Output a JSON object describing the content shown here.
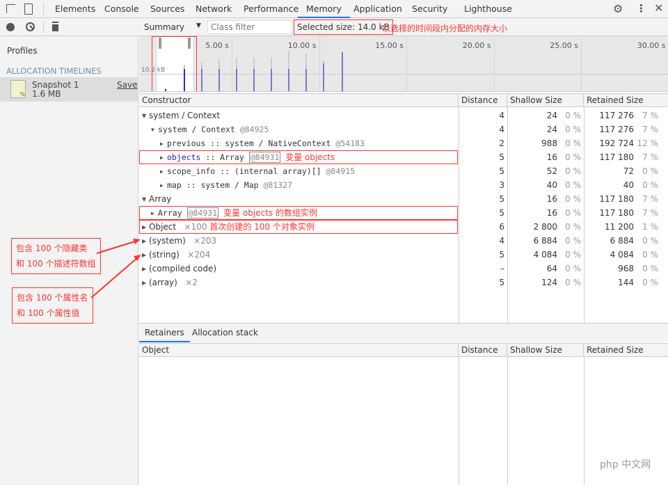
{
  "tabs": [
    "Elements",
    "Console",
    "Sources",
    "Network",
    "Performance",
    "Memory",
    "Application",
    "Security",
    "Lighthouse"
  ],
  "active_tab": "Memory",
  "toolbar": {
    "view": "Summary",
    "class_filter_placeholder": "Class filter",
    "selected_size": "Selected size: 14.0 kB",
    "selected_note": "以选择的时间段内分配的内存大小"
  },
  "sidebar": {
    "profiles": "Profiles",
    "section": "ALLOCATION TIMELINES",
    "snapshot_name": "Snapshot 1",
    "snapshot_size": "1.6 MB",
    "save": "Save"
  },
  "timeline": {
    "ticks": [
      "5.00 s",
      "10.00 s",
      "15.00 s",
      "20.00 s",
      "25.00 s",
      "30.00 s"
    ],
    "size_label": "10.2 kB"
  },
  "columns": [
    "Constructor",
    "Distance",
    "Shallow Size",
    "Retained Size"
  ],
  "rows": [
    {
      "indent": 0,
      "open": true,
      "name": "system / Context",
      "count": "",
      "distance": "4",
      "shallow": "24",
      "shallow_pct": "0 %",
      "retained": "117 276",
      "retained_pct": "7 %"
    },
    {
      "indent": 1,
      "open": true,
      "mono": true,
      "name": "system / Context",
      "id": "@84925",
      "distance": "4",
      "shallow": "24",
      "shallow_pct": "0 %",
      "retained": "117 276",
      "retained_pct": "7 %"
    },
    {
      "indent": 2,
      "mono": true,
      "name": "previous :: system / NativeContext",
      "id": "@54183",
      "distance": "2",
      "shallow": "988",
      "shallow_pct": "0 %",
      "retained": "192 724",
      "retained_pct": "12 %"
    },
    {
      "indent": 2,
      "mono": true,
      "prop": "objects",
      "name": " :: Array",
      "boxid": "@84931",
      "note": "变量 objects",
      "distance": "5",
      "shallow": "16",
      "shallow_pct": "0 %",
      "retained": "117 180",
      "retained_pct": "7 %"
    },
    {
      "indent": 2,
      "mono": true,
      "name": "scope_info :: (internal array)[]",
      "id": "@84915",
      "distance": "5",
      "shallow": "52",
      "shallow_pct": "0 %",
      "retained": "72",
      "retained_pct": "0 %"
    },
    {
      "indent": 2,
      "mono": true,
      "name": "map :: system / Map",
      "id": "@81327",
      "distance": "3",
      "shallow": "40",
      "shallow_pct": "0 %",
      "retained": "40",
      "retained_pct": "0 %"
    },
    {
      "indent": 0,
      "open": true,
      "name": "Array",
      "distance": "5",
      "shallow": "16",
      "shallow_pct": "0 %",
      "retained": "117 180",
      "retained_pct": "7 %"
    },
    {
      "indent": 1,
      "mono": true,
      "name": "Array",
      "boxid": "@84931",
      "note": "变量 objects 的数组实例",
      "distance": "5",
      "shallow": "16",
      "shallow_pct": "0 %",
      "retained": "117 180",
      "retained_pct": "7 %"
    },
    {
      "indent": 0,
      "name": "Object",
      "count": "×100",
      "note": "首次创建的 100 个对象实例",
      "distance": "6",
      "shallow": "2 800",
      "shallow_pct": "0 %",
      "retained": "11 200",
      "retained_pct": "1 %"
    },
    {
      "indent": 0,
      "name": "(system)",
      "count": "×203",
      "distance": "4",
      "shallow": "6 884",
      "shallow_pct": "0 %",
      "retained": "6 884",
      "retained_pct": "0 %"
    },
    {
      "indent": 0,
      "name": "(string)",
      "count": "×204",
      "distance": "5",
      "shallow": "4 084",
      "shallow_pct": "0 %",
      "retained": "4 084",
      "retained_pct": "0 %"
    },
    {
      "indent": 0,
      "name": "(compiled code)",
      "count": "",
      "distance": "–",
      "shallow": "64",
      "shallow_pct": "0 %",
      "retained": "968",
      "retained_pct": "0 %"
    },
    {
      "indent": 0,
      "name": "(array)",
      "count": "×2",
      "distance": "5",
      "shallow": "124",
      "shallow_pct": "0 %",
      "retained": "144",
      "retained_pct": "0 %"
    }
  ],
  "lower_tabs": [
    "Retainers",
    "Allocation stack"
  ],
  "lower_columns": [
    "Object",
    "Distance",
    "Shallow Size",
    "Retained Size"
  ],
  "annotations": [
    {
      "line1": "包含 100 个隐藏类",
      "line2": "和 100 个描述符数组"
    },
    {
      "line1": "包含 100 个属性名",
      "line2": "和 100 个属性值"
    }
  ],
  "watermark": "php 中文网"
}
